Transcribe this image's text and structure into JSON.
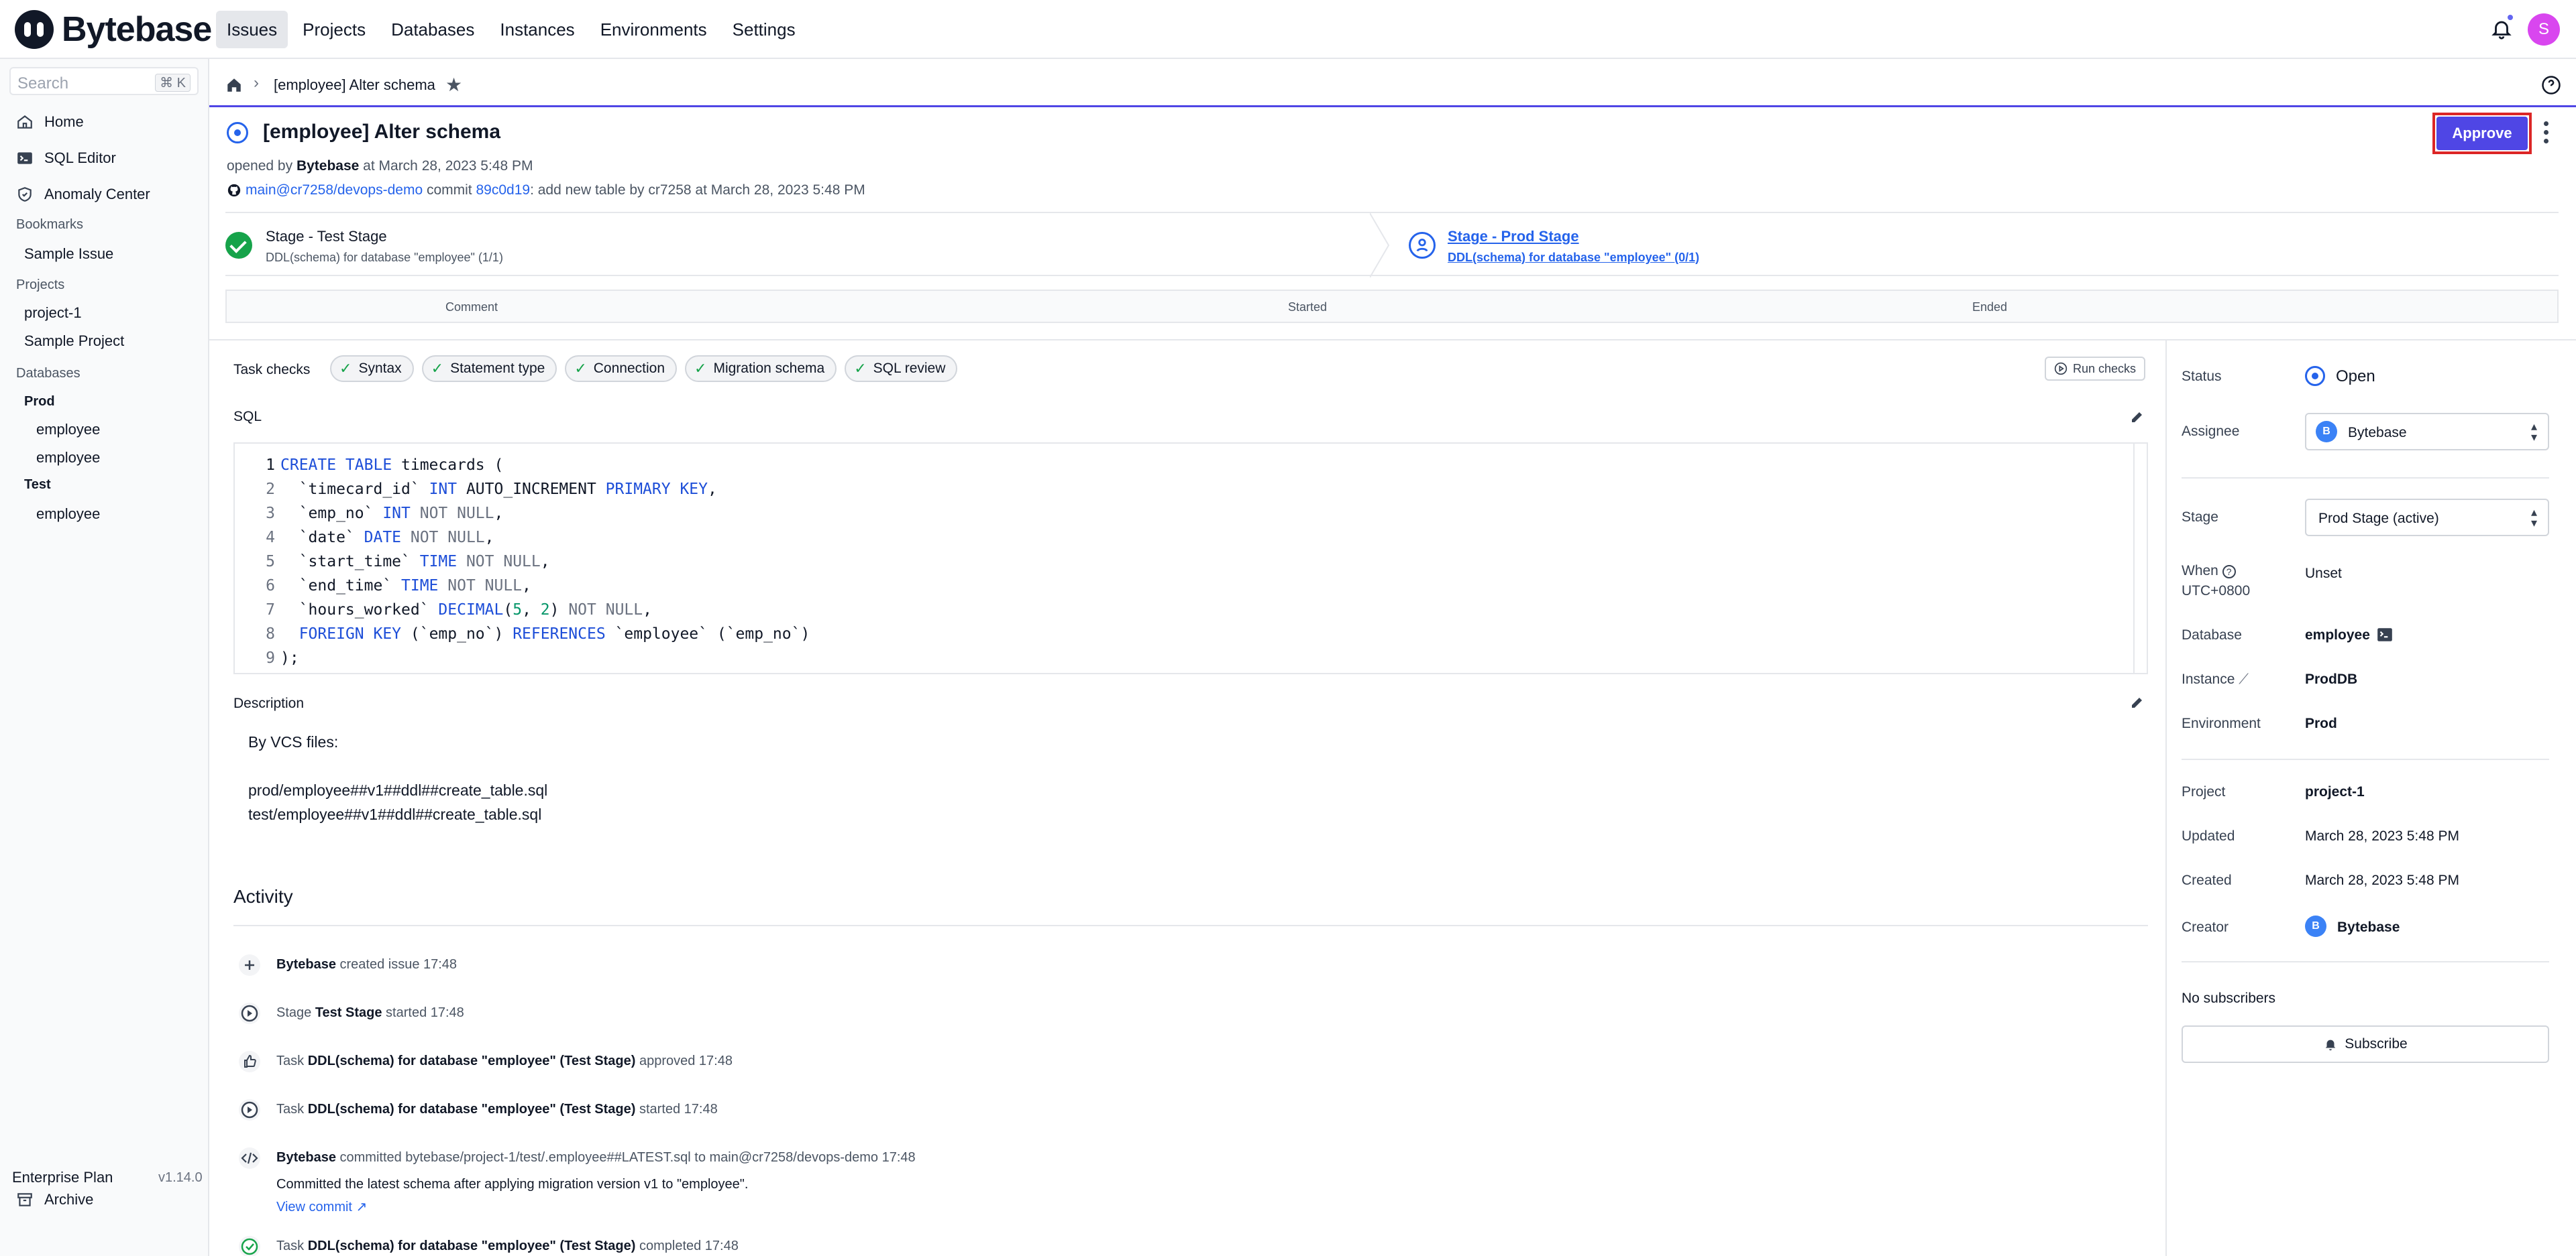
{
  "app": {
    "name": "Bytebase",
    "user_initial": "S"
  },
  "nav": [
    "Issues",
    "Projects",
    "Databases",
    "Instances",
    "Environments",
    "Settings"
  ],
  "sidebar": {
    "search_placeholder": "Search",
    "search_shortcut": "⌘ K",
    "home": "Home",
    "sql_editor": "SQL Editor",
    "anomaly": "Anomaly Center",
    "bookmarks_heading": "Bookmarks",
    "bookmarks": [
      "Sample Issue"
    ],
    "projects_heading": "Projects",
    "projects": [
      "project-1",
      "Sample Project"
    ],
    "databases_heading": "Databases",
    "group_prod": "Prod",
    "prod_dbs": [
      "employee",
      "employee"
    ],
    "group_test": "Test",
    "test_dbs": [
      "employee"
    ],
    "archive": "Archive",
    "plan": "Enterprise Plan",
    "version": "v1.14.0"
  },
  "breadcrumb": {
    "title": "[employee] Alter schema"
  },
  "issue": {
    "title": "[employee] Alter schema",
    "opened_prefix": "opened by",
    "opened_by": "Bytebase",
    "opened_at": "at March 28, 2023 5:48 PM",
    "vcs_branch": "main@cr7258/devops-demo",
    "vcs_commit_word": "commit",
    "vcs_commit": "89c0d19",
    "vcs_msg": ": add new table by cr7258 at March 28, 2023 5:48 PM",
    "approve_label": "Approve"
  },
  "stages": [
    {
      "name": "Stage - Test Stage",
      "task": "DDL(schema) for database \"employee\" (1/1)"
    },
    {
      "name": "Stage - Prod Stage",
      "task": "DDL(schema) for database \"employee\" (0/1)"
    }
  ],
  "task_table": {
    "comment": "Comment",
    "started": "Started",
    "ended": "Ended"
  },
  "checks": {
    "label": "Task checks",
    "items": [
      "Syntax",
      "Statement type",
      "Connection",
      "Migration schema",
      "SQL review"
    ],
    "run_label": "Run checks"
  },
  "sql": {
    "label": "SQL",
    "lines": [
      [
        "1",
        [
          [
            "kw",
            "CREATE TABLE"
          ],
          [
            "",
            " timecards ("
          ]
        ]
      ],
      [
        "2",
        [
          [
            "",
            "  `timecard_id` "
          ],
          [
            "kw",
            "INT"
          ],
          [
            "",
            " AUTO_INCREMENT "
          ],
          [
            "kw",
            "PRIMARY KEY"
          ],
          [
            "",
            ","
          ]
        ]
      ],
      [
        "3",
        [
          [
            "",
            "  `emp_no` "
          ],
          [
            "kw",
            "INT"
          ],
          [
            "nn",
            " NOT NULL"
          ],
          [
            "",
            ","
          ]
        ]
      ],
      [
        "4",
        [
          [
            "",
            "  `date` "
          ],
          [
            "kw",
            "DATE"
          ],
          [
            "nn",
            " NOT NULL"
          ],
          [
            "",
            ","
          ]
        ]
      ],
      [
        "5",
        [
          [
            "",
            "  `start_time` "
          ],
          [
            "kw",
            "TIME"
          ],
          [
            "nn",
            " NOT NULL"
          ],
          [
            "",
            ","
          ]
        ]
      ],
      [
        "6",
        [
          [
            "",
            "  `end_time` "
          ],
          [
            "kw",
            "TIME"
          ],
          [
            "nn",
            " NOT NULL"
          ],
          [
            "",
            ","
          ]
        ]
      ],
      [
        "7",
        [
          [
            "",
            "  `hours_worked` "
          ],
          [
            "kw",
            "DECIMAL"
          ],
          [
            "",
            "("
          ],
          [
            "num",
            "5"
          ],
          [
            "",
            ", "
          ],
          [
            "num",
            "2"
          ],
          [
            "",
            ")"
          ],
          [
            "nn",
            " NOT NULL"
          ],
          [
            "",
            ","
          ]
        ]
      ],
      [
        "8",
        [
          [
            "",
            "  "
          ],
          [
            "kw",
            "FOREIGN KEY"
          ],
          [
            "",
            " (`emp_no`) "
          ],
          [
            "kw",
            "REFERENCES"
          ],
          [
            "",
            " `employee` (`emp_no`)"
          ]
        ]
      ],
      [
        "9",
        [
          [
            "",
            ");"
          ]
        ]
      ]
    ]
  },
  "description": {
    "label": "Description",
    "lines": [
      "By VCS files:",
      "prod/employee##v1##ddl##create_table.sql",
      "test/employee##v1##ddl##create_table.sql"
    ]
  },
  "activity": {
    "title": "Activity",
    "items": [
      {
        "actor": "Bytebase",
        "text": " created issue 17:48"
      },
      {
        "pre": "Stage ",
        "bold": "Test Stage",
        "text": " started 17:48"
      },
      {
        "pre": "Task ",
        "bold": "DDL(schema) for database \"employee\" (Test Stage)",
        "text": " approved 17:48"
      },
      {
        "pre": "Task ",
        "bold": "DDL(schema) for database \"employee\" (Test Stage)",
        "text": " started 17:48"
      },
      {
        "actor": "Bytebase",
        "text": " committed bytebase/project-1/test/.employee##LATEST.sql to main@cr7258/devops-demo 17:48"
      },
      {
        "pre": "Task ",
        "bold": "DDL(schema) for database \"employee\" (Test Stage)",
        "text": " completed 17:48"
      }
    ],
    "commit_note": "Committed the latest schema after applying migration version v1 to \"employee\".",
    "view_commit": "View commit"
  },
  "panel": {
    "status_label": "Status",
    "status": "Open",
    "assignee_label": "Assignee",
    "assignee": "Bytebase",
    "assignee_initial": "B",
    "stage_label": "Stage",
    "stage": "Prod Stage (active)",
    "when_label": "When",
    "when_tz": "UTC+0800",
    "when": "Unset",
    "database_label": "Database",
    "database": "employee",
    "instance_label": "Instance",
    "instance": "ProdDB",
    "environment_label": "Environment",
    "environment": "Prod",
    "project_label": "Project",
    "project": "project-1",
    "updated_label": "Updated",
    "updated": "March 28, 2023 5:48 PM",
    "created_label": "Created",
    "created": "March 28, 2023 5:48 PM",
    "creator_label": "Creator",
    "creator": "Bytebase",
    "creator_initial": "B",
    "subscribers": "No subscribers",
    "subscribe": "Subscribe"
  }
}
